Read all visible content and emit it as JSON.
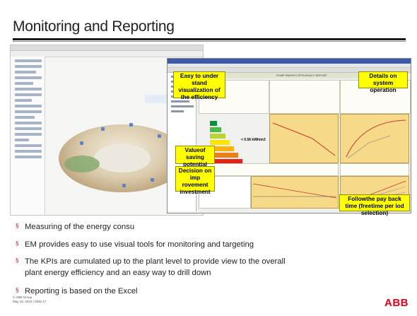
{
  "slide": {
    "title": "Monitoring and Reporting",
    "bullets": [
      {
        "marker": "§",
        "text": "Measuring of the energy consu"
      },
      {
        "marker": "§",
        "text": "EM provides easy to use visual tools for monitoring and targeting"
      },
      {
        "marker": "§",
        "line1": "The KPIs are cumulated up to the plant level to provide view to the overall",
        "line2": "plant energy efficiency and an easy way to drill down"
      },
      {
        "marker": "§",
        "text": "Reporting is based on the Excel"
      }
    ],
    "footer": {
      "line1": "© ABB Group",
      "line2": "May 19, 2010 | Slide 17"
    },
    "logo": "ABB"
  },
  "screenshot": {
    "report_title": "PUMP ENERGY EFFICIENCY REPORT",
    "rating_label": "< 0.56 kWh/m3",
    "rating_letter": "C",
    "callouts": {
      "visualization": "Easy to under stand visualization of the efficiency",
      "details": "Details on system operation",
      "value": "Valueof saving potential",
      "decision": "Decision on imp rovement investment",
      "payback": "Followthe pay back time (freetime per iod selection)"
    }
  },
  "colors": {
    "accent": "#e2001a",
    "callout": "#ffff00",
    "title_rule": "#1a1a1a"
  }
}
